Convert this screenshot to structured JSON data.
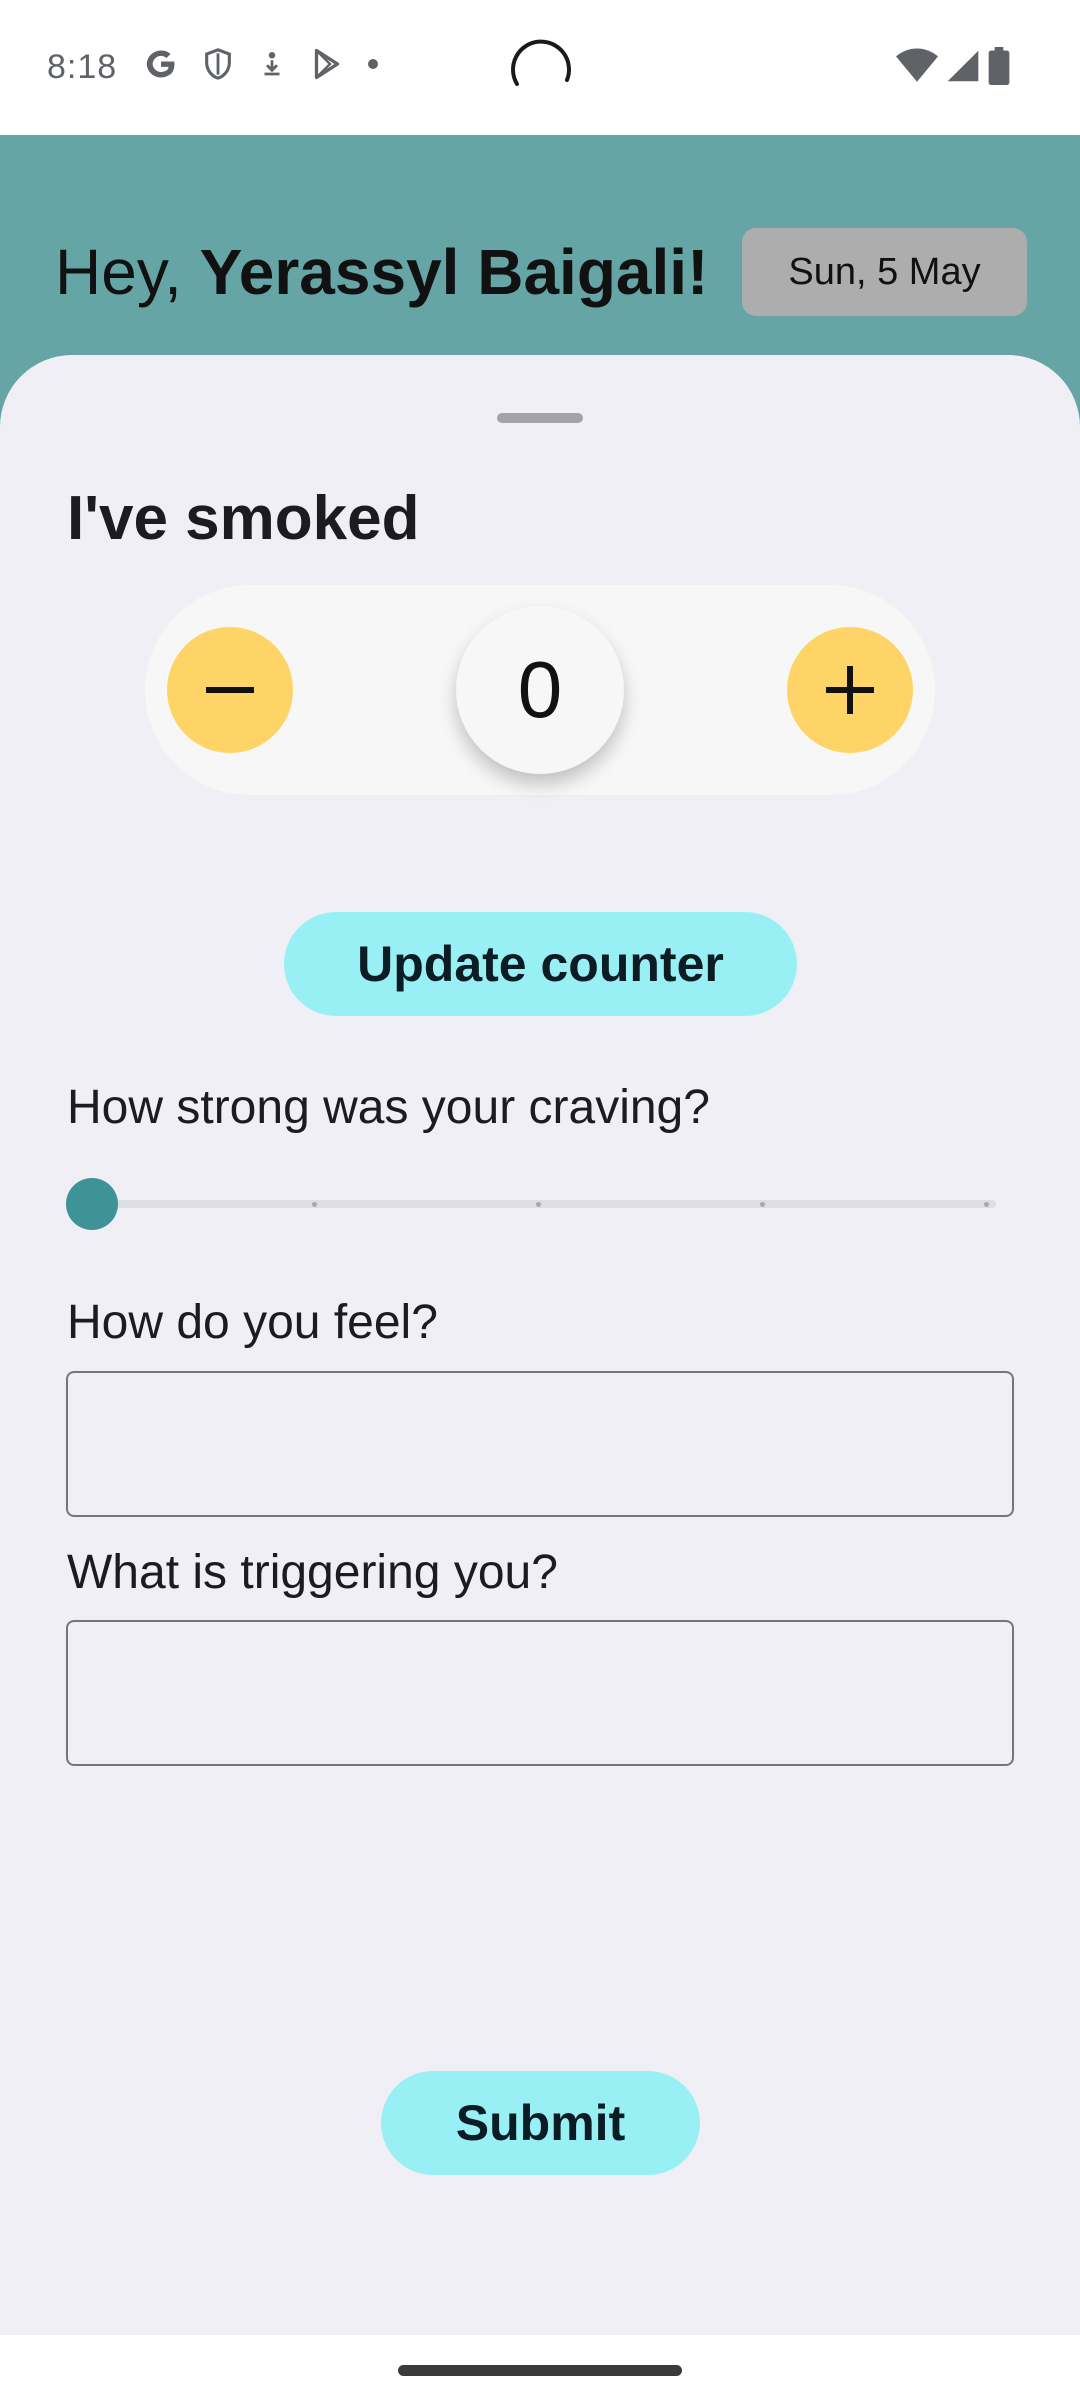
{
  "status_bar": {
    "time": "8:18",
    "left_icons": [
      "google-icon",
      "shield-icon",
      "download-badge-icon",
      "play-store-icon",
      "dot-icon"
    ],
    "right_icons": [
      "wifi-icon",
      "signal-icon",
      "battery-icon"
    ]
  },
  "header": {
    "greeting_prefix": "Hey, ",
    "user_name": "Yerassyl Baigali!",
    "date": "Sun, 5 May",
    "background_color": "#66a5a6"
  },
  "form": {
    "title": "I've smoked",
    "counter": {
      "value": "0",
      "decrement_icon": "minus-icon",
      "increment_icon": "plus-icon",
      "button_color": "#ffd466"
    },
    "update_button_label": "Update counter",
    "craving": {
      "label": "How strong was your craving?",
      "value": 0,
      "min": 0,
      "max": 4,
      "steps": 5,
      "thumb_color": "#3e9399"
    },
    "feel": {
      "label": "How do you feel?",
      "value": ""
    },
    "trigger": {
      "label": "What is triggering you?",
      "value": ""
    },
    "submit_label": "Submit",
    "button_color": "#98f0f5"
  }
}
